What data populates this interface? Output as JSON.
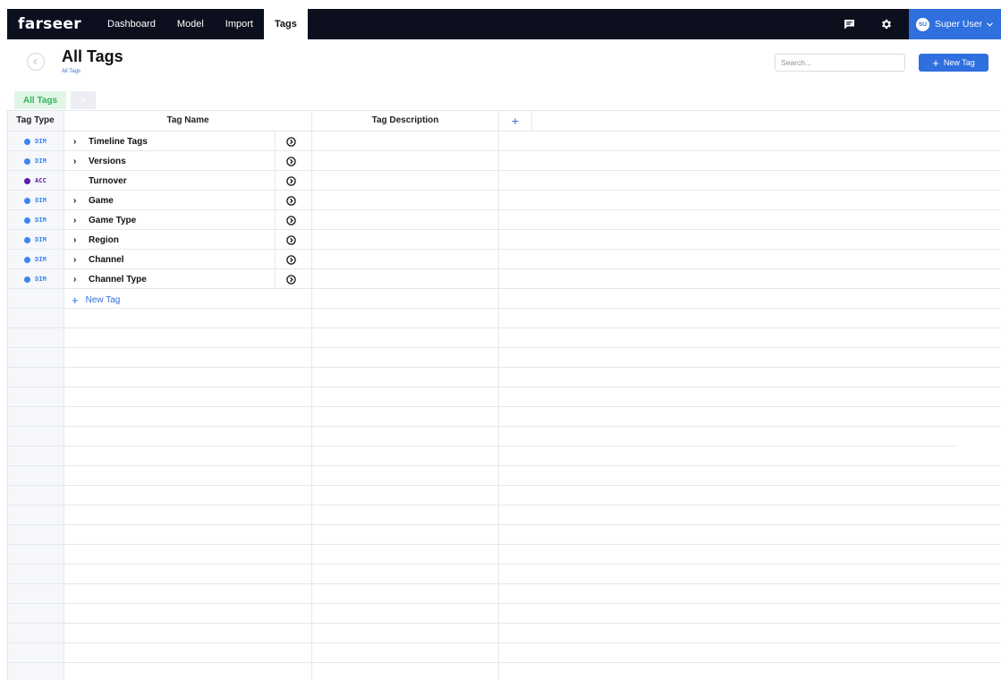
{
  "app": {
    "logo": "farseer",
    "nav_tabs": [
      {
        "label": "Dashboard"
      },
      {
        "label": "Model"
      },
      {
        "label": "Import"
      },
      {
        "label": "Tags"
      }
    ],
    "user": {
      "initials": "SU",
      "name": "Super User"
    }
  },
  "page": {
    "title": "All Tags",
    "breadcrumb": "All Tags",
    "search_placeholder": "Search...",
    "new_tag_label": "New Tag"
  },
  "subtabs": {
    "all": "All Tags",
    "add": "+"
  },
  "table": {
    "headers": {
      "type": "Tag Type",
      "name": "Tag Name",
      "description": "Tag Description",
      "add": "+"
    },
    "rows": [
      {
        "type": "DIM",
        "name": "Timeline Tags",
        "expand": "›"
      },
      {
        "type": "DIM",
        "name": "Versions",
        "expand": "›"
      },
      {
        "type": "ACC",
        "name": "Turnover",
        "expand": ""
      },
      {
        "type": "DIM",
        "name": "Game",
        "expand": "›"
      },
      {
        "type": "DIM",
        "name": "Game Type",
        "expand": "›"
      },
      {
        "type": "DIM",
        "name": "Region",
        "expand": "›"
      },
      {
        "type": "DIM",
        "name": "Channel",
        "expand": "›"
      },
      {
        "type": "DIM",
        "name": "Channel Type",
        "expand": "›"
      }
    ],
    "new_row_label": "New Tag"
  },
  "colors": {
    "topbar": "#0b0f1e",
    "accent_blue": "#2f6fde",
    "dim_dot": "#3a86ee",
    "acc_dot": "#5a1ea6",
    "tab_green": "#2fb45a"
  },
  "icons": {
    "chat": "chat-icon",
    "settings": "gear-icon",
    "back": "back-arrow-icon",
    "open": "circle-chevron-right-icon"
  }
}
